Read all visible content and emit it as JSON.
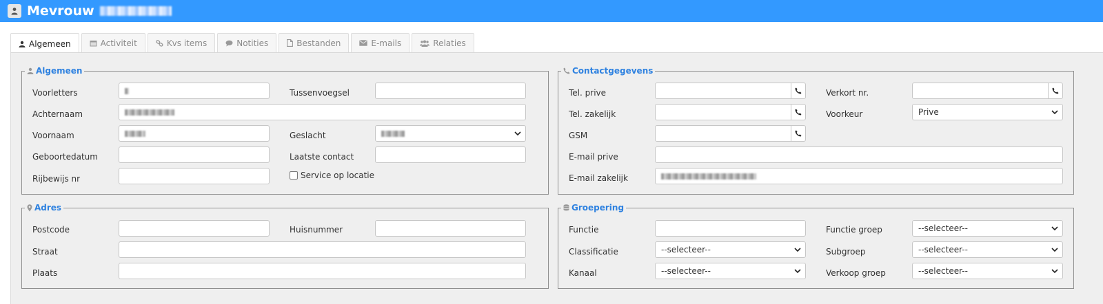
{
  "header": {
    "salutation": "Mevrouw",
    "name_blurred": true
  },
  "tabs": [
    {
      "label": "Algemeen",
      "icon": "user-icon",
      "active": true
    },
    {
      "label": "Activiteit",
      "icon": "calendar-icon",
      "active": false
    },
    {
      "label": "Kvs items",
      "icon": "link-icon",
      "active": false
    },
    {
      "label": "Notities",
      "icon": "comment-icon",
      "active": false
    },
    {
      "label": "Bestanden",
      "icon": "file-icon",
      "active": false
    },
    {
      "label": "E-mails",
      "icon": "envelope-icon",
      "active": false
    },
    {
      "label": "Relaties",
      "icon": "users-icon",
      "active": false
    }
  ],
  "algemeen": {
    "legend": "Algemeen",
    "voorletters_label": "Voorletters",
    "tussenvoegsel_label": "Tussenvoegsel",
    "achternaam_label": "Achternaam",
    "voornaam_label": "Voornaam",
    "geslacht_label": "Geslacht",
    "geboortedatum_label": "Geboortedatum",
    "laatste_contact_label": "Laatste contact",
    "rijbewijs_label": "Rijbewijs nr",
    "service_label": "Service op locatie",
    "tussenvoegsel_value": "",
    "geboortedatum_value": "",
    "laatste_contact_value": "",
    "rijbewijs_value": ""
  },
  "adres": {
    "legend": "Adres",
    "postcode_label": "Postcode",
    "huisnummer_label": "Huisnummer",
    "straat_label": "Straat",
    "plaats_label": "Plaats",
    "postcode_value": "",
    "huisnummer_value": "",
    "straat_value": "",
    "plaats_value": ""
  },
  "contact": {
    "legend": "Contactgegevens",
    "tel_prive_label": "Tel. prive",
    "verkort_label": "Verkort nr.",
    "tel_zakelijk_label": "Tel. zakelijk",
    "voorkeur_label": "Voorkeur",
    "voorkeur_value": "Prive",
    "gsm_label": "GSM",
    "email_prive_label": "E-mail prive",
    "email_zakelijk_label": "E-mail zakelijk"
  },
  "groepering": {
    "legend": "Groepering",
    "functie_label": "Functie",
    "functie_groep_label": "Functie groep",
    "functie_groep_value": "--selecteer--",
    "classificatie_label": "Classificatie",
    "classificatie_value": "--selecteer--",
    "subgroep_label": "Subgroep",
    "subgroep_value": "--selecteer--",
    "kanaal_label": "Kanaal",
    "kanaal_value": "--selecteer--",
    "verkoop_groep_label": "Verkoop groep",
    "verkoop_groep_value": "--selecteer--"
  },
  "colors": {
    "header_bg": "#3399ff",
    "legend": "#2f82e0"
  }
}
